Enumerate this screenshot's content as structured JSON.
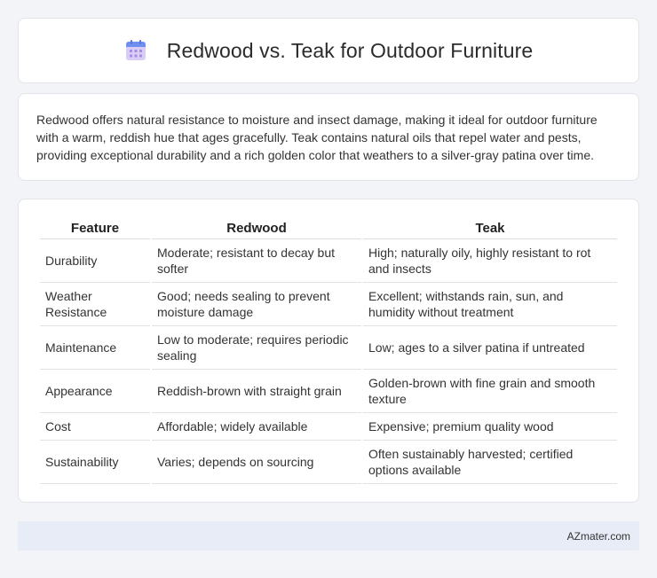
{
  "header": {
    "title": "Redwood vs. Teak for Outdoor Furniture",
    "icon": "calendar-icon",
    "icon_colors": {
      "top": "#6f8ff0",
      "body": "#c9b8ef",
      "dots": "#a58be2"
    }
  },
  "intro": {
    "text": "Redwood offers natural resistance to moisture and insect damage, making it ideal for outdoor furniture with a warm, reddish hue that ages gracefully. Teak contains natural oils that repel water and pests, providing exceptional durability and a rich golden color that weathers to a silver-gray patina over time."
  },
  "table": {
    "headers": [
      "Feature",
      "Redwood",
      "Teak"
    ],
    "rows": [
      [
        "Durability",
        "Moderate; resistant to decay but softer",
        "High; naturally oily, highly resistant to rot and insects"
      ],
      [
        "Weather Resistance",
        "Good; needs sealing to prevent moisture damage",
        "Excellent; withstands rain, sun, and humidity without treatment"
      ],
      [
        "Maintenance",
        "Low to moderate; requires periodic sealing",
        "Low; ages to a silver patina if untreated"
      ],
      [
        "Appearance",
        "Reddish-brown with straight grain",
        "Golden-brown with fine grain and smooth texture"
      ],
      [
        "Cost",
        "Affordable; widely available",
        "Expensive; premium quality wood"
      ],
      [
        "Sustainability",
        "Varies; depends on sourcing",
        "Often sustainably harvested; certified options available"
      ]
    ]
  },
  "footer": {
    "brand": "AZmater.com"
  }
}
